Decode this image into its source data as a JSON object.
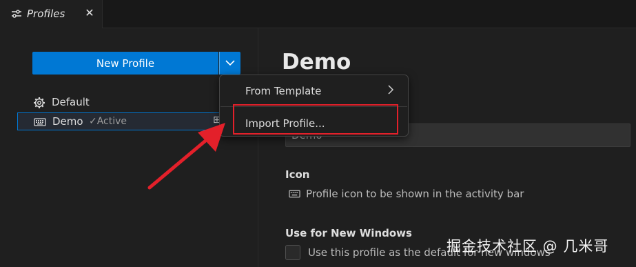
{
  "tab": {
    "label": "Profiles",
    "close": "✕",
    "icon": "settings-sliders-icon"
  },
  "sidebar": {
    "new_profile_label": "New Profile",
    "profiles": [
      {
        "label": "Default",
        "icon": "gear-icon",
        "active_text": ""
      },
      {
        "label": "Demo",
        "icon": "keyboard-icon",
        "active_text": "✓Active",
        "selected": true
      }
    ]
  },
  "editor": {
    "title": "Demo",
    "name_value": "Demo",
    "icon_heading": "Icon",
    "icon_description": "Profile icon to be shown in the activity bar",
    "new_windows_heading": "Use for New Windows",
    "new_windows_checkbox_label": "Use this profile as the default for new windows"
  },
  "menu": {
    "items": [
      {
        "label": "From Template",
        "has_submenu": true
      },
      {
        "label": "Import Profile...",
        "highlighted": true
      }
    ]
  },
  "watermark": "掘金技术社区 @ 几米哥",
  "colors": {
    "accent": "#0078d4",
    "annotation": "#e3202a",
    "background": "#1f1f1f"
  }
}
